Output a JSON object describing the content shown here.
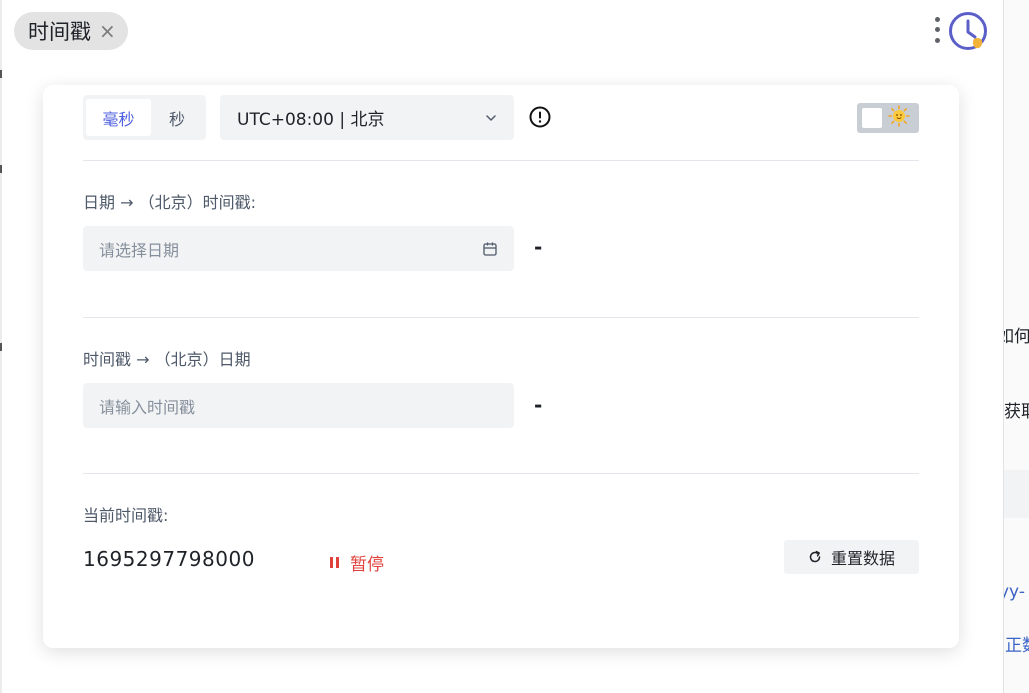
{
  "tab": {
    "title": "时间戳",
    "close_symbol": "×"
  },
  "header": {
    "menu_icon": "more-vertical-icon",
    "logo_icon": "clock-logo-icon"
  },
  "unit_toggle": {
    "options": [
      "毫秒",
      "秒"
    ],
    "selected": "毫秒"
  },
  "timezone": {
    "value": "UTC+08:00 | 北京"
  },
  "info_icon": "info-circle-icon",
  "theme_toggle": {
    "icon": "sun-emoji-icon",
    "state": "light"
  },
  "date_to_ts": {
    "label": "日期 → （北京）时间戳:",
    "placeholder": "请选择日期",
    "result": "-"
  },
  "ts_to_date": {
    "label": "时间戳 → （北京）日期",
    "placeholder": "请输入时间戳",
    "result": "-"
  },
  "current": {
    "label": "当前时间戳:",
    "value": "1695297798000",
    "pause_label": "暂停",
    "reset_label": "重置数据"
  },
  "background_page": {
    "fragments": [
      "如何",
      "获取",
      "yy-",
      "正数"
    ]
  },
  "colors": {
    "accent": "#4d5fe0",
    "danger": "#e0413b",
    "field_bg": "#f2f3f5"
  }
}
